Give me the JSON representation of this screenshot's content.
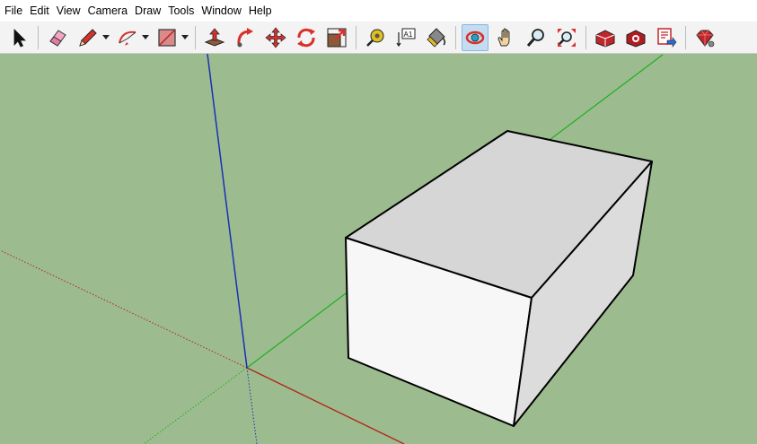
{
  "menubar": {
    "items": [
      {
        "label": "File"
      },
      {
        "label": "Edit"
      },
      {
        "label": "View"
      },
      {
        "label": "Camera"
      },
      {
        "label": "Draw"
      },
      {
        "label": "Tools"
      },
      {
        "label": "Window"
      },
      {
        "label": "Help"
      }
    ]
  },
  "toolbar": {
    "text_tool_glyph": "A1",
    "tools": [
      {
        "name": "select",
        "icon": "arrow-cursor-icon"
      },
      {
        "name": "eraser",
        "icon": "eraser-icon"
      },
      {
        "name": "line",
        "icon": "pencil-icon"
      },
      {
        "name": "arc",
        "icon": "arc-icon"
      },
      {
        "name": "rectangle",
        "icon": "rectangle-icon"
      },
      {
        "name": "push-pull",
        "icon": "push-pull-icon"
      },
      {
        "name": "follow-me",
        "icon": "follow-me-icon"
      },
      {
        "name": "move",
        "icon": "move-icon"
      },
      {
        "name": "rotate",
        "icon": "rotate-icon"
      },
      {
        "name": "scale",
        "icon": "scale-icon"
      },
      {
        "name": "tape-measure",
        "icon": "tape-measure-icon"
      },
      {
        "name": "text",
        "icon": "text-icon"
      },
      {
        "name": "paint-bucket",
        "icon": "paint-bucket-icon"
      },
      {
        "name": "orbit",
        "icon": "orbit-icon",
        "active": true
      },
      {
        "name": "pan",
        "icon": "pan-hand-icon"
      },
      {
        "name": "zoom",
        "icon": "zoom-icon"
      },
      {
        "name": "zoom-extents",
        "icon": "zoom-extents-icon"
      },
      {
        "name": "3d-warehouse",
        "icon": "warehouse-icon"
      },
      {
        "name": "extension-warehouse",
        "icon": "extension-warehouse-icon"
      },
      {
        "name": "send-to-layout",
        "icon": "layout-icon"
      },
      {
        "name": "extension-manager",
        "icon": "ruby-gem-icon"
      }
    ]
  },
  "colors": {
    "viewport_background": "#9cbc8f",
    "toolbar_background": "#f3f3f3",
    "axis_red": "#b3231c",
    "axis_green": "#1fae1f",
    "axis_blue": "#1a2fb8",
    "box_top_face": "#d6d6d6",
    "box_front_face": "#f7f7f7",
    "box_side_face": "#dcdcdc",
    "active_tool_highlight": "#c5dcf0"
  }
}
